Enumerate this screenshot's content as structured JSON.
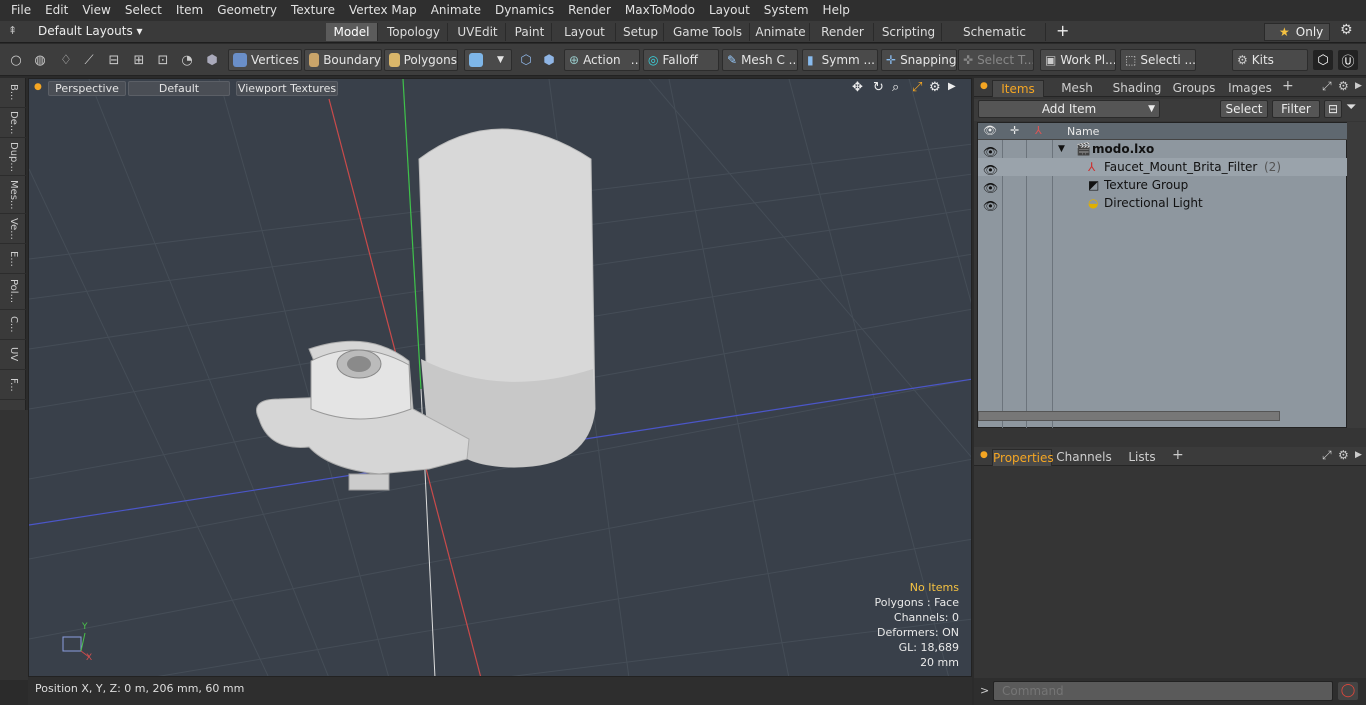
{
  "menu": [
    "File",
    "Edit",
    "View",
    "Select",
    "Item",
    "Geometry",
    "Texture",
    "Vertex Map",
    "Animate",
    "Dynamics",
    "Render",
    "MaxToModo",
    "Layout",
    "System",
    "Help"
  ],
  "layout_selector": "Default Layouts ▾",
  "layout_tabs": [
    "Model",
    "Topology",
    "UVEdit",
    "Paint",
    "Layout",
    "Setup",
    "Game Tools",
    "Animate",
    "Render",
    "Scripting",
    "Schematic Fusion"
  ],
  "only_label": "Only",
  "toolbar": {
    "vertices": "Vertices",
    "boundary": "Boundary",
    "polygons": "Polygons",
    "action": "Action",
    "falloff": "Falloff",
    "meshc": "Mesh C ...",
    "symm": "Symm ...",
    "snapping": "Snapping",
    "selectt": "Select T...",
    "workpl": "Work Pl...",
    "selecti": "Selecti ...",
    "kits": "Kits"
  },
  "left_tabs": [
    "B...",
    "De...",
    "Dup...",
    "Mes...",
    "Ve...",
    "E...",
    "Pol...",
    "C...",
    "UV",
    "F..."
  ],
  "viewport": {
    "perspective": "Perspective",
    "default": "Default",
    "textures": "Viewport Textures",
    "stats": {
      "items": "No Items",
      "polygons": "Polygons : Face",
      "channels": "Channels: 0",
      "deformers": "Deformers: ON",
      "gl": "GL: 18,689",
      "scale": "20 mm"
    },
    "axis_y": "Y",
    "axis_x": "X"
  },
  "status": "Position X, Y, Z:   0 m, 206 mm, 60 mm",
  "panel_tabs": [
    "Items",
    "Mesh Ops",
    "Shading",
    "Groups",
    "Images"
  ],
  "items_bar": {
    "add_item": "Add Item",
    "select": "Select",
    "filter": "Filter"
  },
  "tree": {
    "header": "Name",
    "rows": [
      {
        "name": "modo.lxo",
        "count": ""
      },
      {
        "name": "Faucet_Mount_Brita_Filter",
        "count": "(2)"
      },
      {
        "name": "Texture Group",
        "count": ""
      },
      {
        "name": "Directional Light",
        "count": ""
      }
    ]
  },
  "prop_tabs": [
    "Properties",
    "Channels",
    "Lists"
  ],
  "command_placeholder": "Command",
  "colors": {
    "accent": "#f5a623",
    "viewport_bg": "#39404a"
  }
}
